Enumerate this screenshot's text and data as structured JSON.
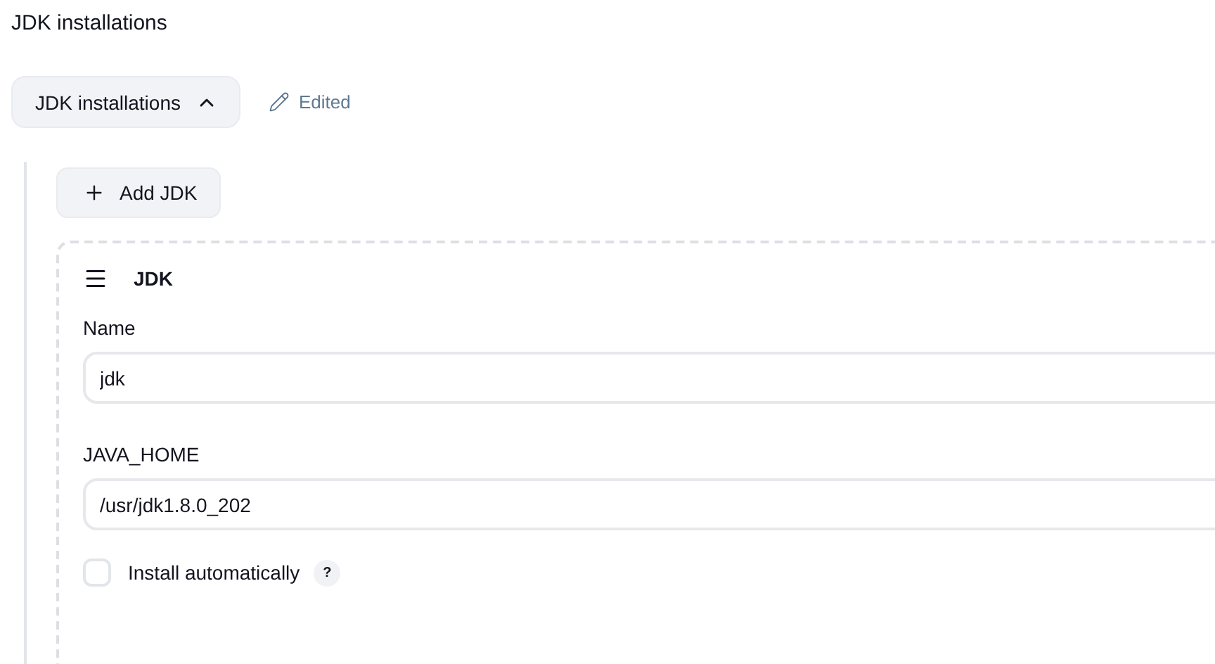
{
  "page_title": "JDK installations",
  "section_toggle": {
    "label": "JDK installations",
    "expanded": true
  },
  "status": {
    "label": "Edited"
  },
  "add_button": {
    "label": "Add JDK"
  },
  "jdk_card": {
    "title": "JDK",
    "fields": [
      {
        "label": "Name",
        "value": "jdk"
      },
      {
        "label": "JAVA_HOME",
        "value": "/usr/jdk1.8.0_202"
      }
    ],
    "install_automatically": {
      "label": "Install automatically",
      "checked": false,
      "help": "?"
    }
  }
}
